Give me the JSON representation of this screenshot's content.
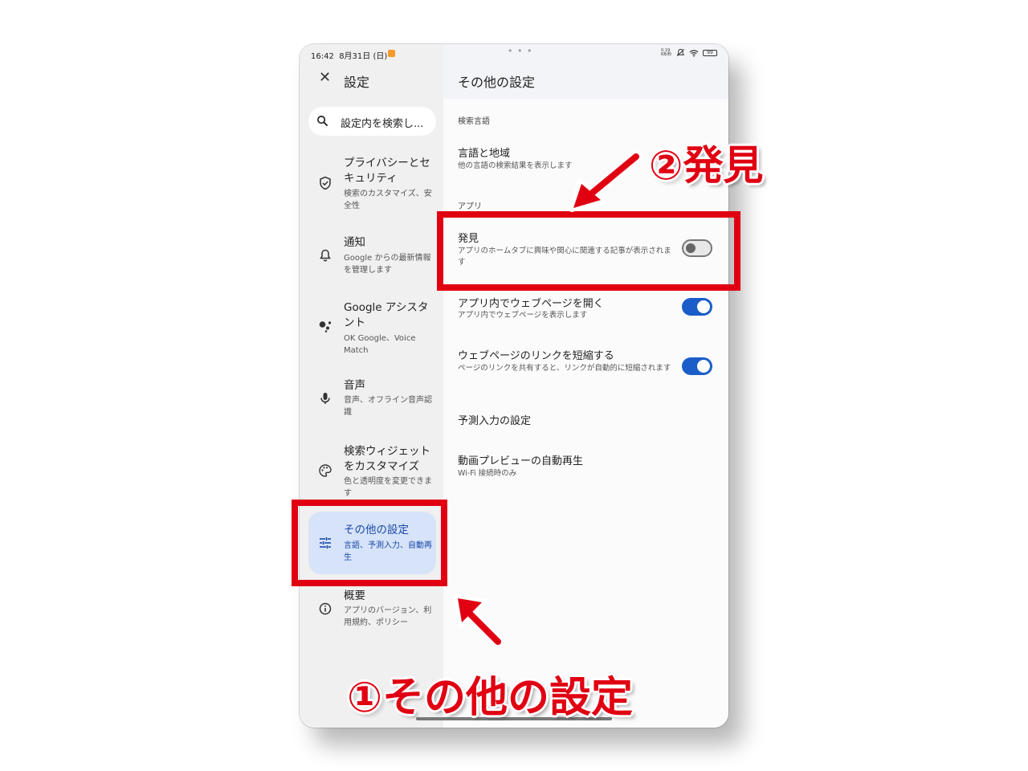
{
  "status_bar": {
    "time": "16:42",
    "date": "8月31日 (日)",
    "dots": "• • •",
    "speed": "0.19 KB/秒",
    "battery": "99"
  },
  "left_pane": {
    "close_icon": "close-icon",
    "title": "設定",
    "search_placeholder": "設定内を検索し...",
    "items": [
      {
        "icon": "shield-check-icon",
        "title": "プライバシーとセキュリティ",
        "subtitle": "検索のカスタマイズ、安全性"
      },
      {
        "icon": "bell-icon",
        "title": "通知",
        "subtitle": "Google からの最新情報を管理します"
      },
      {
        "icon": "google-assistant-icon",
        "title": "Google アシスタント",
        "subtitle": "OK Google、Voice Match"
      },
      {
        "icon": "mic-icon",
        "title": "音声",
        "subtitle": "音声、オフライン音声認識"
      },
      {
        "icon": "palette-icon",
        "title": "検索ウィジェットをカスタマイズ",
        "subtitle": "色と透明度を変更できます"
      },
      {
        "icon": "tune-icon",
        "title": "その他の設定",
        "subtitle": "言語、予測入力、自動再生",
        "active": true
      },
      {
        "icon": "info-icon",
        "title": "概要",
        "subtitle": "アプリのバージョン、利用規約、ポリシー"
      }
    ]
  },
  "right_pane": {
    "title": "その他の設定",
    "section_search_language": "検索言語",
    "language_row": {
      "title": "言語と地域",
      "subtitle": "他の言語の検索結果を表示します"
    },
    "section_app": "アプリ",
    "discover_row": {
      "title": "発見",
      "subtitle": "アプリのホームタブに興味や関心に関連する記事が表示されます",
      "toggle": false
    },
    "open_in_app_row": {
      "title": "アプリ内でウェブページを開く",
      "subtitle": "アプリ内でウェブページを表示します",
      "toggle": true
    },
    "shorten_links_row": {
      "title": "ウェブページのリンクを短縮する",
      "subtitle": "ページのリンクを共有すると、リンクが自動的に短縮されます",
      "toggle": true
    },
    "autocomplete_row": {
      "title": "予測入力の設定"
    },
    "video_preview_row": {
      "title": "動画プレビューの自動再生",
      "subtitle": "Wi-Fi 接続時のみ"
    }
  },
  "annotations": {
    "step1": "①その他の設定",
    "step2": "②発見",
    "color": "#e00012"
  },
  "colors": {
    "active_nav_bg": "#d6e3f8",
    "active_nav_text": "#1a49a8",
    "toggle_on": "#1a5dc8"
  }
}
